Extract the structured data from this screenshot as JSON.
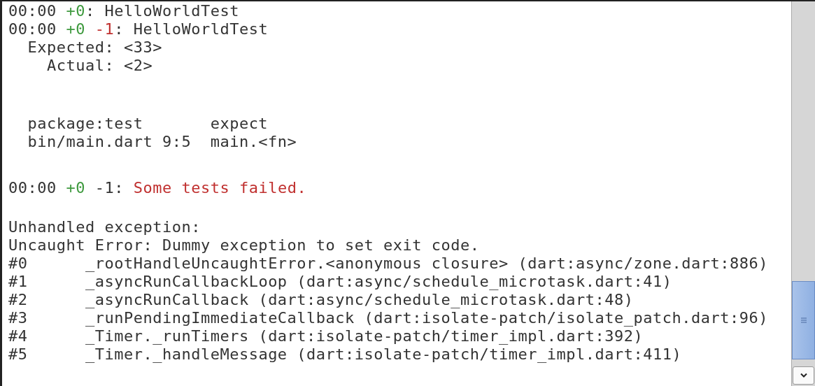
{
  "console": {
    "blocks": [
      {
        "lines": [
          [
            {
              "kind": "plain",
              "text": "00:00 "
            },
            {
              "kind": "pass",
              "text": "+0"
            },
            {
              "kind": "plain",
              "text": ": HelloWorldTest"
            }
          ],
          [
            {
              "kind": "plain",
              "text": "00:00 "
            },
            {
              "kind": "pass",
              "text": "+0"
            },
            {
              "kind": "fail",
              "text": " -1"
            },
            {
              "kind": "plain",
              "text": ": HelloWorldTest"
            }
          ],
          [
            {
              "kind": "plain",
              "text": "  Expected: <33>"
            }
          ],
          [
            {
              "kind": "plain",
              "text": "    Actual: <2>"
            }
          ]
        ]
      },
      {
        "lines": [
          [
            {
              "kind": "plain",
              "text": "  package:test       expect"
            }
          ],
          [
            {
              "kind": "plain",
              "text": "  bin/main.dart 9:5  main.<fn>"
            }
          ]
        ]
      },
      {
        "lines": [
          [
            {
              "kind": "plain",
              "text": "00:00 "
            },
            {
              "kind": "pass",
              "text": "+0"
            },
            {
              "kind": "plain",
              "text": " -1: "
            },
            {
              "kind": "fail",
              "text": "Some tests failed."
            }
          ]
        ]
      },
      {
        "lines": [
          [
            {
              "kind": "plain",
              "text": "Unhandled exception:"
            }
          ],
          [
            {
              "kind": "plain",
              "text": "Uncaught Error: Dummy exception to set exit code."
            }
          ],
          [
            {
              "kind": "plain",
              "text": "#0\t_rootHandleUncaughtError.<anonymous closure> (dart:async/zone.dart:886)"
            }
          ],
          [
            {
              "kind": "plain",
              "text": "#1\t_asyncRunCallbackLoop (dart:async/schedule_microtask.dart:41)"
            }
          ],
          [
            {
              "kind": "plain",
              "text": "#2\t_asyncRunCallback (dart:async/schedule_microtask.dart:48)"
            }
          ],
          [
            {
              "kind": "plain",
              "text": "#3\t_runPendingImmediateCallback (dart:isolate-patch/isolate_patch.dart:96)"
            }
          ],
          [
            {
              "kind": "plain",
              "text": "#4\t_Timer._runTimers (dart:isolate-patch/timer_impl.dart:392)"
            }
          ],
          [
            {
              "kind": "plain",
              "text": "#5\t_Timer._handleMessage (dart:isolate-patch/timer_impl.dart:411)"
            }
          ]
        ]
      }
    ]
  }
}
